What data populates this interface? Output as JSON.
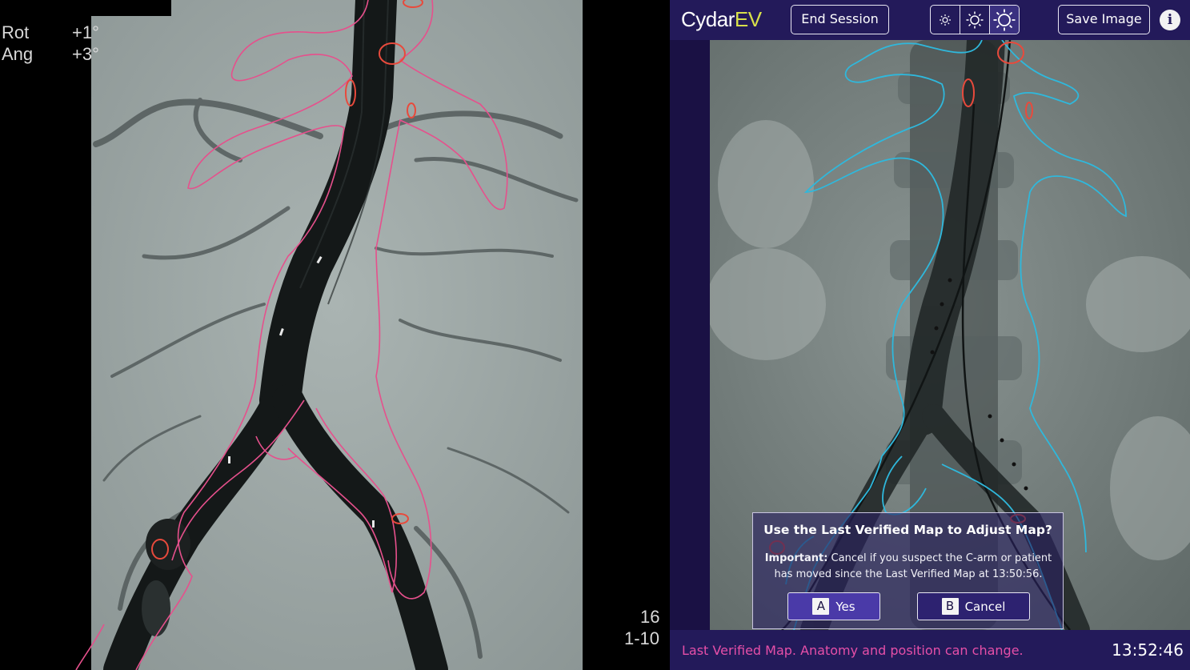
{
  "left_monitor": {
    "rotation_label": "Rot",
    "rotation_value": "+1°",
    "angulation_label": "Ang",
    "angulation_value": "+3°",
    "frame_count": "16",
    "series_range": "1-10"
  },
  "cydar": {
    "logo": {
      "brand": "Cydar",
      "product": "EV"
    },
    "toolbar": {
      "end_session_label": "End Session",
      "save_image_label": "Save Image",
      "info_label": "i",
      "brightness_levels": [
        "low",
        "medium",
        "high"
      ],
      "brightness_selected": "high"
    },
    "dialog": {
      "title": "Use the Last Verified Map to Adjust Map?",
      "important_label": "Important:",
      "body": " Cancel if you suspect the C-arm or patient has moved since the Last Verified Map at 13:50:56.",
      "yes_key": "A",
      "yes_label": "Yes",
      "cancel_key": "B",
      "cancel_label": "Cancel"
    },
    "status": {
      "message": "Last Verified Map. Anatomy and position can change.",
      "clock": "13:52:46"
    }
  },
  "colors": {
    "toolbar_bg": "#231a5a",
    "logo_ev": "#d8e04a",
    "status_text": "#e64fa8",
    "angio_overlay": "#e6508c",
    "fluoro_overlay": "#2fb8dc",
    "ostium_markers": "#e84a3c"
  },
  "icons": {
    "brightness": "sun-icon",
    "info": "info-icon"
  }
}
